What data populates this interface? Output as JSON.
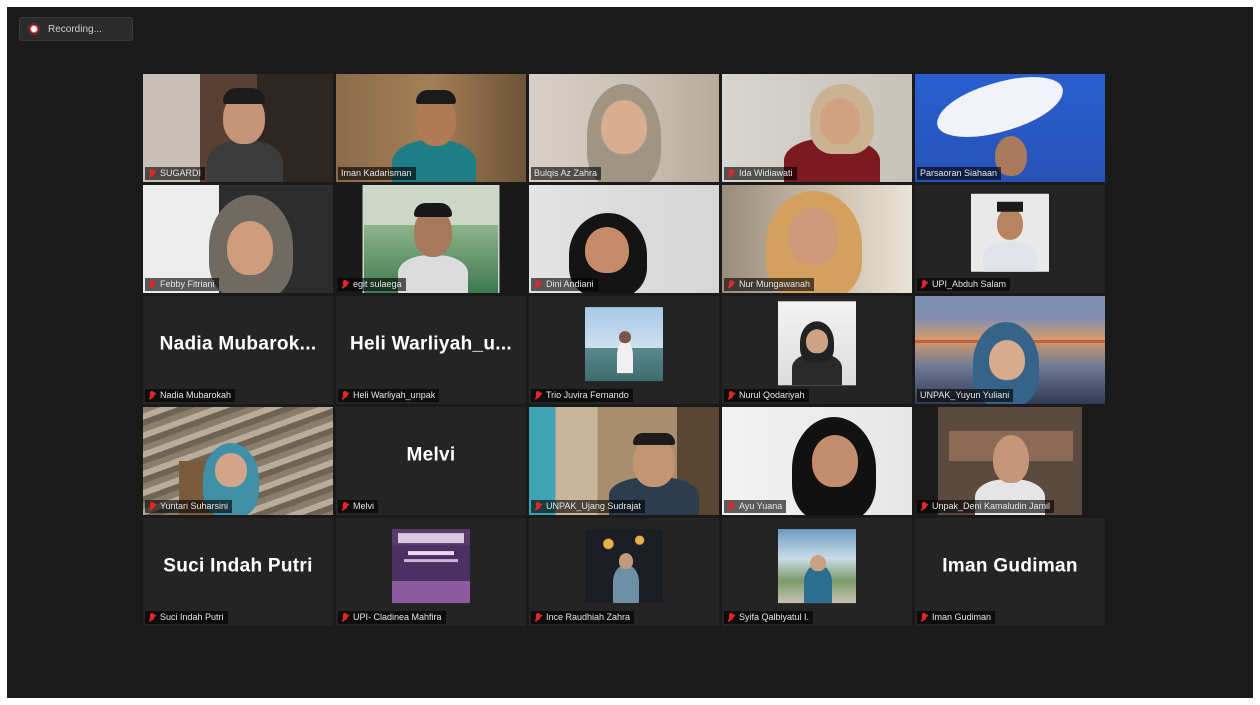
{
  "recording": {
    "label": "Recording..."
  },
  "accent": {
    "active_speaker": "#c7e34a",
    "muted_mic": "#e5252a"
  },
  "participants": [
    {
      "name": "SUGARDI",
      "display": "",
      "muted": true,
      "kind": "video"
    },
    {
      "name": "Iman Kadarisman",
      "display": "",
      "muted": false,
      "kind": "video"
    },
    {
      "name": "Bulqis Az Zahra",
      "display": "",
      "muted": false,
      "kind": "video"
    },
    {
      "name": "Ida Widiawati",
      "display": "",
      "muted": true,
      "kind": "video"
    },
    {
      "name": "Parsaoran Siahaan",
      "display": "",
      "muted": false,
      "kind": "video",
      "active": true
    },
    {
      "name": "Febby Fitriani",
      "display": "",
      "muted": true,
      "kind": "video"
    },
    {
      "name": "egit sulaega",
      "display": "",
      "muted": true,
      "kind": "video"
    },
    {
      "name": "Dini Andiani",
      "display": "",
      "muted": true,
      "kind": "video"
    },
    {
      "name": "Nur Mungawanah",
      "display": "",
      "muted": true,
      "kind": "video"
    },
    {
      "name": "UPI_Abduh Salam",
      "display": "",
      "muted": true,
      "kind": "photo"
    },
    {
      "name": "Nadia Mubarokah",
      "display": "Nadia Mubarok...",
      "muted": true,
      "kind": "text"
    },
    {
      "name": "Heli Warliyah_unpak",
      "display": "Heli Warliyah_u...",
      "muted": true,
      "kind": "text"
    },
    {
      "name": "Trio Juvira Fernando",
      "display": "",
      "muted": true,
      "kind": "photo"
    },
    {
      "name": "Nurul Qodariyah",
      "display": "",
      "muted": true,
      "kind": "photo"
    },
    {
      "name": "UNPAK_Yuyun Yuliani",
      "display": "",
      "muted": false,
      "kind": "video"
    },
    {
      "name": "Yuntari Suharsini",
      "display": "",
      "muted": true,
      "kind": "video"
    },
    {
      "name": "Melvi",
      "display": "Melvi",
      "muted": true,
      "kind": "text"
    },
    {
      "name": "UNPAK_Ujang Sudrajat",
      "display": "",
      "muted": true,
      "kind": "video"
    },
    {
      "name": "Ayu Yuana",
      "display": "",
      "muted": true,
      "kind": "video"
    },
    {
      "name": "Unpak_Deni Kamaludin Jamil",
      "display": "",
      "muted": true,
      "kind": "video"
    },
    {
      "name": "Suci Indah Putri",
      "display": "Suci Indah Putri",
      "muted": true,
      "kind": "text"
    },
    {
      "name": "UPI- Cladinea Mahfira",
      "display": "",
      "muted": true,
      "kind": "photo"
    },
    {
      "name": "Ince Raudhiah Zahra",
      "display": "",
      "muted": true,
      "kind": "photo"
    },
    {
      "name": "Syifa Qalbiyatul I.",
      "display": "",
      "muted": true,
      "kind": "photo"
    },
    {
      "name": "Iman Gudiman",
      "display": "Iman Gudiman",
      "muted": true,
      "kind": "text"
    }
  ]
}
